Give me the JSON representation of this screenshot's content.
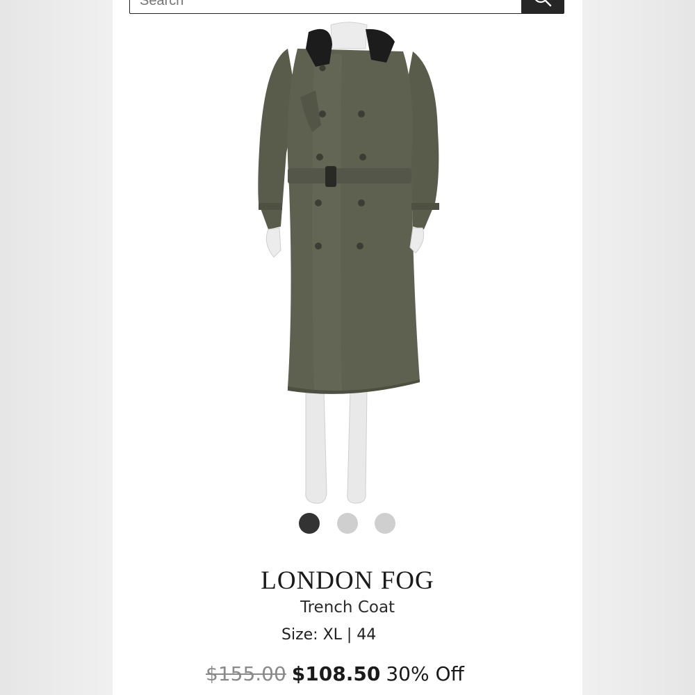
{
  "search": {
    "placeholder": "Search",
    "icon": "search-icon"
  },
  "product": {
    "brand": "LONDON FOG",
    "type": "Trench Coat",
    "size_label": "Size: XL | 44",
    "price_original": "$155.00",
    "price_sale": "$108.50",
    "discount": "30% Off",
    "image_count": 3,
    "active_image_index": 0
  },
  "colors": {
    "coat": "#5e604f",
    "collar": "#1c1c1c",
    "active_dot": "#333333",
    "inactive_dot": "#cfcfcf"
  }
}
